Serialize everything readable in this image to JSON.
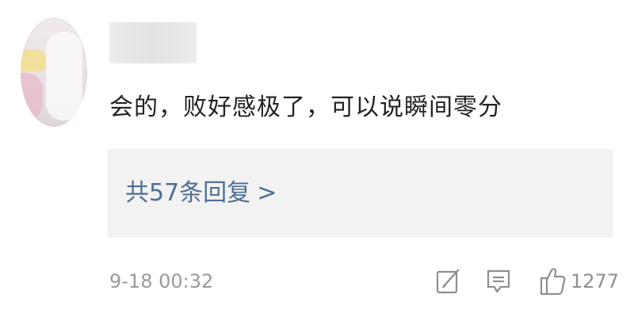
{
  "comment": {
    "text": "会的，败好感极了，可以说瞬间零分"
  },
  "replies": {
    "label": "共57条回复",
    "chevron": ">"
  },
  "meta": {
    "timestamp": "9-18 00:32"
  },
  "actions": {
    "edit_icon": "edit-icon",
    "comment_icon": "comment-icon",
    "like_icon": "thumbs-up-icon",
    "like_count": "1277"
  },
  "colors": {
    "link": "#4f6f95",
    "text": "#222222",
    "muted": "#9a9a9a",
    "reply_bg": "#f2f2f2"
  }
}
